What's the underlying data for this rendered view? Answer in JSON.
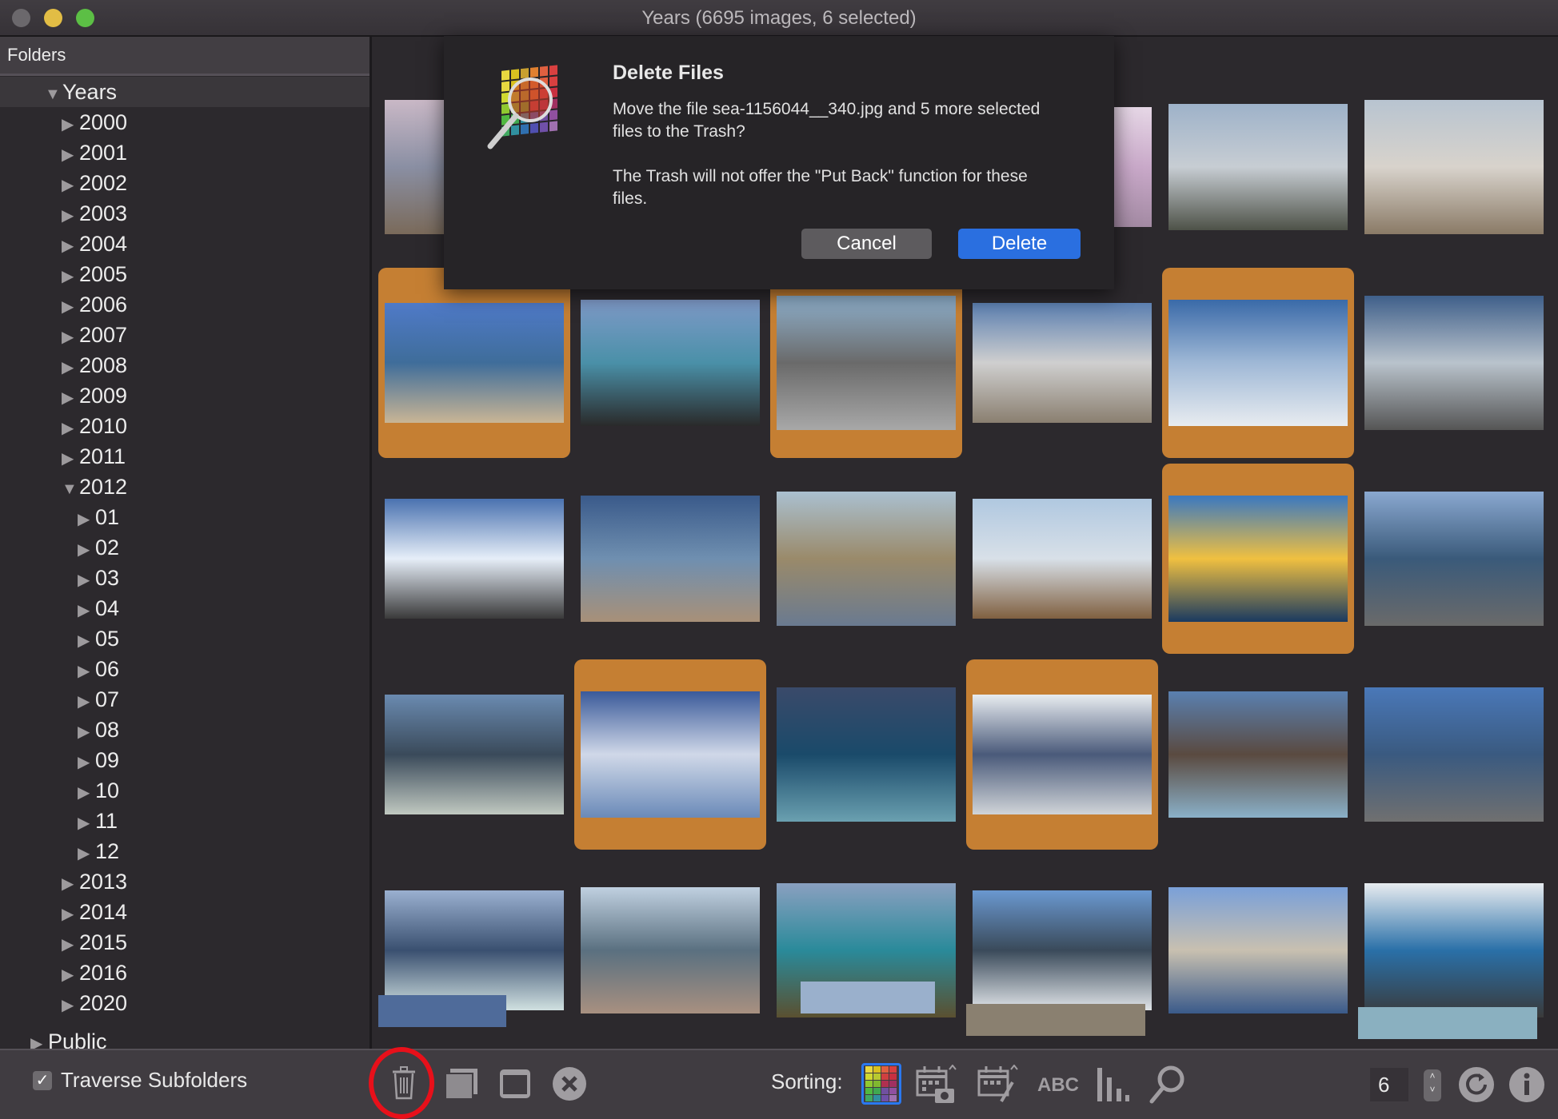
{
  "window": {
    "title": "Years (6695 images, 6 selected)",
    "traffic_lights": {
      "close": "#6b686c",
      "minimize": "#e2bd45",
      "zoom": "#5cbf45"
    }
  },
  "sidebar": {
    "header": "Folders",
    "tree": [
      {
        "label": "Years",
        "level": 0,
        "expanded": true,
        "selected": true
      },
      {
        "label": "2000",
        "level": 1,
        "expanded": false
      },
      {
        "label": "2001",
        "level": 1,
        "expanded": false
      },
      {
        "label": "2002",
        "level": 1,
        "expanded": false
      },
      {
        "label": "2003",
        "level": 1,
        "expanded": false
      },
      {
        "label": "2004",
        "level": 1,
        "expanded": false
      },
      {
        "label": "2005",
        "level": 1,
        "expanded": false
      },
      {
        "label": "2006",
        "level": 1,
        "expanded": false
      },
      {
        "label": "2007",
        "level": 1,
        "expanded": false
      },
      {
        "label": "2008",
        "level": 1,
        "expanded": false
      },
      {
        "label": "2009",
        "level": 1,
        "expanded": false
      },
      {
        "label": "2010",
        "level": 1,
        "expanded": false
      },
      {
        "label": "2011",
        "level": 1,
        "expanded": false
      },
      {
        "label": "2012",
        "level": 1,
        "expanded": true
      },
      {
        "label": "01",
        "level": 2,
        "expanded": false
      },
      {
        "label": "02",
        "level": 2,
        "expanded": false
      },
      {
        "label": "03",
        "level": 2,
        "expanded": false
      },
      {
        "label": "04",
        "level": 2,
        "expanded": false
      },
      {
        "label": "05",
        "level": 2,
        "expanded": false
      },
      {
        "label": "06",
        "level": 2,
        "expanded": false
      },
      {
        "label": "07",
        "level": 2,
        "expanded": false
      },
      {
        "label": "08",
        "level": 2,
        "expanded": false
      },
      {
        "label": "09",
        "level": 2,
        "expanded": false
      },
      {
        "label": "10",
        "level": 2,
        "expanded": false
      },
      {
        "label": "11",
        "level": 2,
        "expanded": false
      },
      {
        "label": "12",
        "level": 2,
        "expanded": false
      },
      {
        "label": "2013",
        "level": 1,
        "expanded": false
      },
      {
        "label": "2014",
        "level": 1,
        "expanded": false
      },
      {
        "label": "2015",
        "level": 1,
        "expanded": false
      },
      {
        "label": "2016",
        "level": 1,
        "expanded": false
      },
      {
        "label": "2020",
        "level": 1,
        "expanded": false
      },
      {
        "label": "Public",
        "level": -1,
        "expanded": false
      }
    ]
  },
  "grid": {
    "selection_color": "#c57f33",
    "thumbnails": [
      {
        "row": 0,
        "col": 0,
        "selected": false,
        "scene": "beach-sunset",
        "colors": [
          "#c9b8c6",
          "#8a8fa3",
          "#7a6a5a"
        ]
      },
      {
        "row": 0,
        "col": 3,
        "selected": false,
        "scene": "pink-sky",
        "colors": [
          "#e6d7e6",
          "#c9a9c9",
          "#a38aa3"
        ]
      },
      {
        "row": 0,
        "col": 4,
        "selected": false,
        "scene": "geyser-steam",
        "colors": [
          "#9eb2c9",
          "#c7cdd3",
          "#4e5248"
        ]
      },
      {
        "row": 0,
        "col": 5,
        "selected": false,
        "scene": "frosty-field",
        "colors": [
          "#b8c4d0",
          "#d8d3cc",
          "#8a7a66"
        ]
      },
      {
        "row": 1,
        "col": 0,
        "selected": true,
        "scene": "sandy-beach",
        "colors": [
          "#4f7ac8",
          "#3f6d9a",
          "#c9b595"
        ]
      },
      {
        "row": 1,
        "col": 1,
        "selected": false,
        "scene": "rocky-sea",
        "colors": [
          "#7f9ac8",
          "#4a90a8",
          "#2a2a2a"
        ]
      },
      {
        "row": 1,
        "col": 2,
        "selected": true,
        "scene": "sand-ripples",
        "colors": [
          "#8fb0cc",
          "#6a6a6a",
          "#a8a8a8"
        ]
      },
      {
        "row": 1,
        "col": 3,
        "selected": false,
        "scene": "snowy-path",
        "colors": [
          "#5b7fb0",
          "#cfcfcf",
          "#8a7f70"
        ]
      },
      {
        "row": 1,
        "col": 4,
        "selected": true,
        "scene": "snow-sun",
        "colors": [
          "#3a6aa8",
          "#9fb8d6",
          "#e8ecf0"
        ]
      },
      {
        "row": 1,
        "col": 5,
        "selected": false,
        "scene": "cloudy-lake",
        "colors": [
          "#3f5f8a",
          "#b9c3cc",
          "#555555"
        ]
      },
      {
        "row": 2,
        "col": 0,
        "selected": false,
        "scene": "cirrus-sky",
        "colors": [
          "#4a72b0",
          "#e6eef8",
          "#3a3a3a"
        ]
      },
      {
        "row": 2,
        "col": 1,
        "selected": false,
        "scene": "wave-shore",
        "colors": [
          "#3a5a8a",
          "#6f8fb0",
          "#a89078"
        ]
      },
      {
        "row": 2,
        "col": 2,
        "selected": false,
        "scene": "road",
        "colors": [
          "#aac0d0",
          "#9a8a6a",
          "#6a7a90"
        ]
      },
      {
        "row": 2,
        "col": 3,
        "selected": false,
        "scene": "salt-flats",
        "colors": [
          "#b0c8e0",
          "#d8e0e8",
          "#806040"
        ]
      },
      {
        "row": 2,
        "col": 4,
        "selected": true,
        "scene": "golden-sunset",
        "colors": [
          "#3a78c0",
          "#f0c040",
          "#1a3a60"
        ]
      },
      {
        "row": 2,
        "col": 5,
        "selected": false,
        "scene": "coastal-rocks",
        "colors": [
          "#8aa8d0",
          "#3a5a7a",
          "#6a6a6a"
        ]
      },
      {
        "row": 3,
        "col": 0,
        "selected": false,
        "scene": "stormy-waves",
        "colors": [
          "#6a8ab0",
          "#3a4a5a",
          "#c0c8c0"
        ]
      },
      {
        "row": 3,
        "col": 1,
        "selected": true,
        "scene": "breaking-waves",
        "colors": [
          "#3a5a9a",
          "#d0d8e8",
          "#6a8ab8"
        ]
      },
      {
        "row": 3,
        "col": 2,
        "selected": false,
        "scene": "dark-surf",
        "colors": [
          "#3a4a6a",
          "#1a4a6a",
          "#6aa0b0"
        ]
      },
      {
        "row": 3,
        "col": 3,
        "selected": true,
        "scene": "snowy-mountains",
        "colors": [
          "#e8ecf0",
          "#4a5a7a",
          "#d0d4d8"
        ]
      },
      {
        "row": 3,
        "col": 4,
        "selected": false,
        "scene": "rocky-coast",
        "colors": [
          "#5a80b0",
          "#5a4a40",
          "#8ab0c8"
        ]
      },
      {
        "row": 3,
        "col": 5,
        "selected": false,
        "scene": "cliff-shore",
        "colors": [
          "#4a78b8",
          "#3a5a80",
          "#707070"
        ]
      },
      {
        "row": 4,
        "col": 0,
        "selected": false,
        "scene": "ship-wake",
        "colors": [
          "#9ab0d0",
          "#3a5070",
          "#d0e0e0"
        ]
      },
      {
        "row": 4,
        "col": 1,
        "selected": false,
        "scene": "foam-beach",
        "colors": [
          "#c0d0e0",
          "#5a7080",
          "#a89080"
        ]
      },
      {
        "row": 4,
        "col": 2,
        "selected": false,
        "scene": "turquoise-waves",
        "colors": [
          "#8aa0c0",
          "#2a8a9a",
          "#5a5030"
        ]
      },
      {
        "row": 4,
        "col": 3,
        "selected": false,
        "scene": "island-clouds",
        "colors": [
          "#6a98d0",
          "#3a4a5a",
          "#e0e4e8"
        ]
      },
      {
        "row": 4,
        "col": 4,
        "selected": false,
        "scene": "rocky-spit",
        "colors": [
          "#7aa0d8",
          "#c8c0b0",
          "#3a5a8a"
        ]
      },
      {
        "row": 4,
        "col": 5,
        "selected": false,
        "scene": "cliff-spray",
        "colors": [
          "#e8ecf0",
          "#2a70a8",
          "#3a3a3a"
        ]
      }
    ]
  },
  "dialog": {
    "title": "Delete Files",
    "message": "Move the file sea-1156044__340.jpg and 5 more selected files to the Trash?",
    "note": "The Trash will not offer the \"Put Back\" function for these files.",
    "cancel_label": "Cancel",
    "delete_label": "Delete",
    "icon": "color-grid-magnifier-icon"
  },
  "toolbar": {
    "traverse_label": "Traverse Subfolders",
    "traverse_checked": true,
    "sorting_label": "Sorting:",
    "thumb_count": "6",
    "left_icons": [
      "trash-icon",
      "stack-icon",
      "window-icon",
      "close-circle-icon"
    ],
    "sort_icons": [
      "color-grid-icon",
      "calendar-camera-icon",
      "calendar-edit-icon",
      "abc-icon",
      "bar-chart-icon",
      "magnifier-icon"
    ],
    "right_icons": [
      "refresh-icon",
      "info-icon"
    ],
    "highlight_color": "#e8101a"
  }
}
